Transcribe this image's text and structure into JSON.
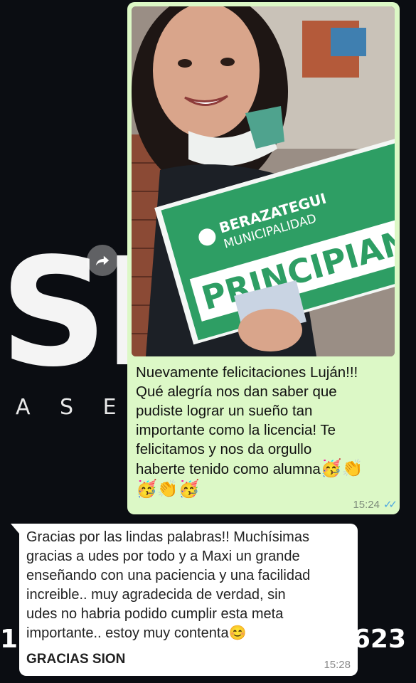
{
  "wallpaper": {
    "big_letters": "SI",
    "subtitle": "A S E S",
    "phone_left": "1",
    "phone_right": "623"
  },
  "outgoing": {
    "photo": {
      "sign_brand": "BERAZATEGUI",
      "sign_sub": "MUNICIPALIDAD",
      "sign_word": "PRINCIPIANT"
    },
    "text": "Nuevamente felicitaciones Luján!!!\nQué alegría nos dan saber que\npudiste lograr un sueño tan\nimportante como la licencia! Te\nfelicitamos y nos da orgullo\nhaberte tenido como alumna",
    "emoji_inline": "🥳👏",
    "emoji_line": "🥳👏🥳",
    "time": "15:24",
    "status": "read"
  },
  "incoming": {
    "text": "Gracias por las lindas palabras!! Muchísimas\ngracias a udes por todo y a Maxi un grande\nenseñando con una paciencia y una facilidad\nincreible.. muy agradecida de verdad, sin\nudes no habria podido cumplir esta meta\nimportante.. estoy muy contenta😊",
    "signature": "GRACIAS SION",
    "time": "15:28"
  },
  "colors": {
    "outgoing_bg": "#dcf8c6",
    "incoming_bg": "#ffffff",
    "read_ticks": "#4fa8e0",
    "sign_green": "#2e9e64"
  }
}
